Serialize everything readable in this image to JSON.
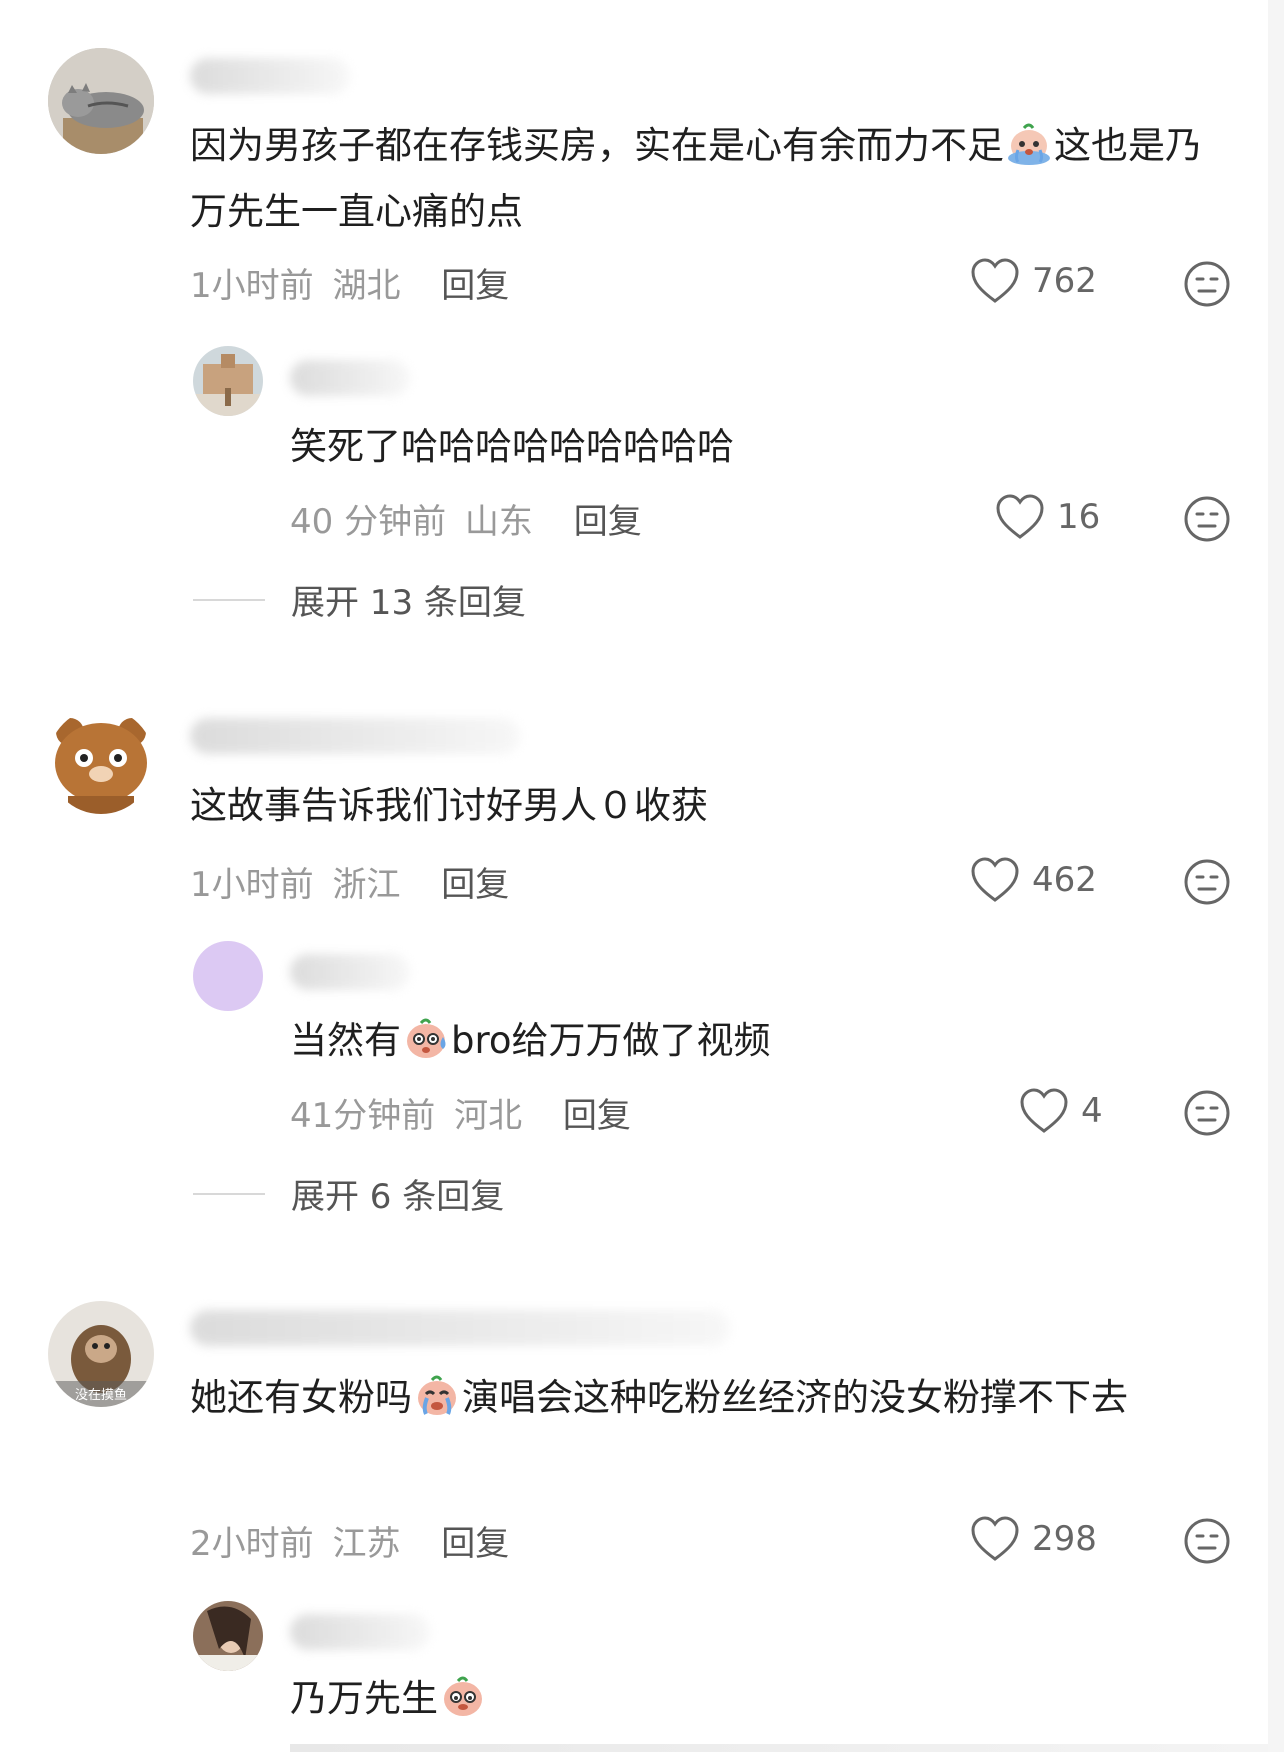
{
  "comments": [
    {
      "text_before": "因为男孩子都在存钱买房，实在是心有余而力不足",
      "emoji": "crying-emoji",
      "text_after": "这也是乃万先生一直心痛的点",
      "time": "1小时前",
      "location": "湖北",
      "reply_label": "回复",
      "likes": "762",
      "subreply": {
        "text": "笑死了哈哈哈哈哈哈哈哈哈",
        "time": "40 分钟前",
        "location": "山东",
        "reply_label": "回复",
        "likes": "16"
      },
      "expand_label": "展开 13 条回复"
    },
    {
      "text": "这故事告诉我们讨好男人０收获",
      "time": "1小时前",
      "location": "浙江",
      "reply_label": "回复",
      "likes": "462",
      "subreply": {
        "text_before": "当然有",
        "emoji": "sweat-emoji",
        "text_after": "bro给万万做了视频",
        "time": "41分钟前",
        "location": "河北",
        "reply_label": "回复",
        "likes": "4"
      },
      "expand_label": "展开 6 条回复"
    },
    {
      "text_before": "她还有女粉吗",
      "emoji": "crying-emoji",
      "text_after": "演唱会这种吃粉丝经济的没女粉撑不下去",
      "time": "2小时前",
      "location": "江苏",
      "reply_label": "回复",
      "likes": "298",
      "avatar_caption": "没在摸鱼",
      "subreply": {
        "text_before": "乃万先生",
        "emoji": "shy-emoji"
      }
    }
  ],
  "colors": {
    "text": "#1f1f1f",
    "meta": "#999999",
    "reply": "#555555",
    "icon": "#666666"
  }
}
